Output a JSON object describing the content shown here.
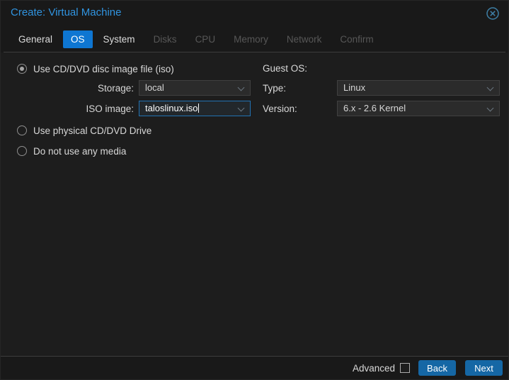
{
  "window": {
    "title": "Create: Virtual Machine"
  },
  "tabs": [
    {
      "label": "General",
      "state": "enabled"
    },
    {
      "label": "OS",
      "state": "active"
    },
    {
      "label": "System",
      "state": "enabled"
    },
    {
      "label": "Disks",
      "state": "disabled"
    },
    {
      "label": "CPU",
      "state": "disabled"
    },
    {
      "label": "Memory",
      "state": "disabled"
    },
    {
      "label": "Network",
      "state": "disabled"
    },
    {
      "label": "Confirm",
      "state": "disabled"
    }
  ],
  "media": {
    "options": [
      {
        "label": "Use CD/DVD disc image file (iso)",
        "selected": true
      },
      {
        "label": "Use physical CD/DVD Drive",
        "selected": false
      },
      {
        "label": "Do not use any media",
        "selected": false
      }
    ],
    "storage": {
      "label": "Storage:",
      "value": "local"
    },
    "iso": {
      "label": "ISO image:",
      "value": "taloslinux.iso"
    }
  },
  "guest_os": {
    "heading": "Guest OS:",
    "type": {
      "label": "Type:",
      "value": "Linux"
    },
    "version": {
      "label": "Version:",
      "value": "6.x - 2.6 Kernel"
    }
  },
  "footer": {
    "advanced_label": "Advanced",
    "advanced_checked": false,
    "back_label": "Back",
    "next_label": "Next"
  },
  "colors": {
    "accent_blue": "#0e76d2",
    "button_blue": "#1567a5",
    "title_blue": "#3094e0",
    "focus_border": "#2272b2"
  }
}
